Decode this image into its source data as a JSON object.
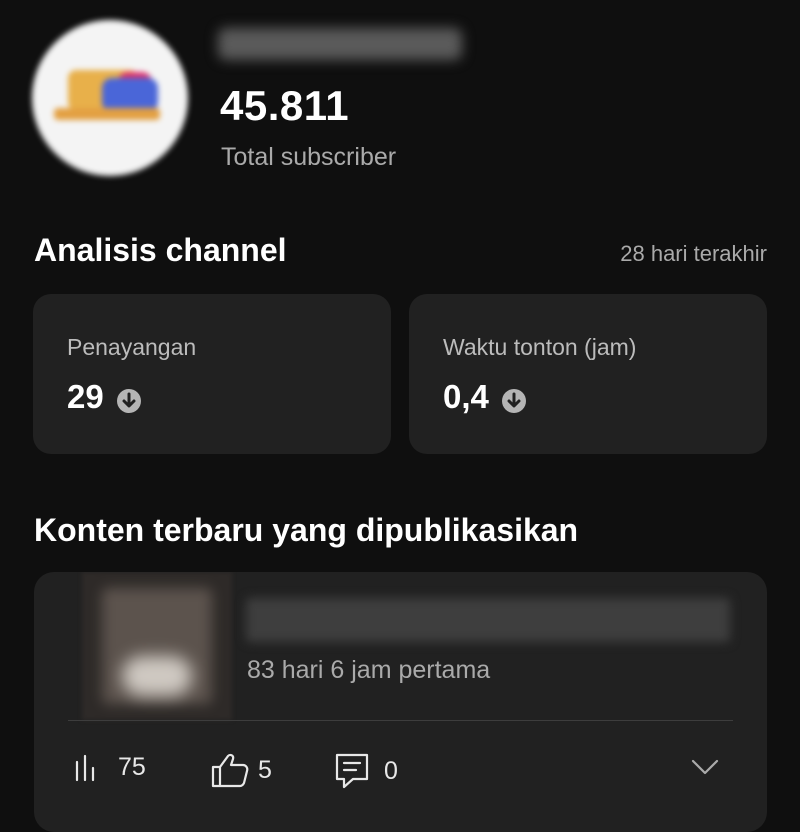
{
  "channel": {
    "subscriber_count": "45.811",
    "subscriber_label": "Total subscriber"
  },
  "analytics": {
    "title": "Analisis channel",
    "range_label": "28 hari terakhir",
    "cards": [
      {
        "label": "Penayangan",
        "value": "29",
        "trend": "down"
      },
      {
        "label": "Waktu tonton (jam)",
        "value": "0,4",
        "trend": "down"
      }
    ]
  },
  "latest_content": {
    "title": "Konten terbaru yang dipublikasikan",
    "video": {
      "meta": "83 hari 6 jam pertama",
      "stats": {
        "views": "75",
        "likes": "5",
        "comments": "0"
      }
    }
  },
  "icons": {
    "trend": "arrow-down-circle-icon",
    "views": "bar-chart-icon",
    "likes": "thumbs-up-icon",
    "comments": "comment-icon",
    "expand": "chevron-down-icon"
  },
  "colors": {
    "background": "#0f0f0f",
    "card": "#212121",
    "text": "#ffffff",
    "secondary_text": "#aaaaaa"
  }
}
